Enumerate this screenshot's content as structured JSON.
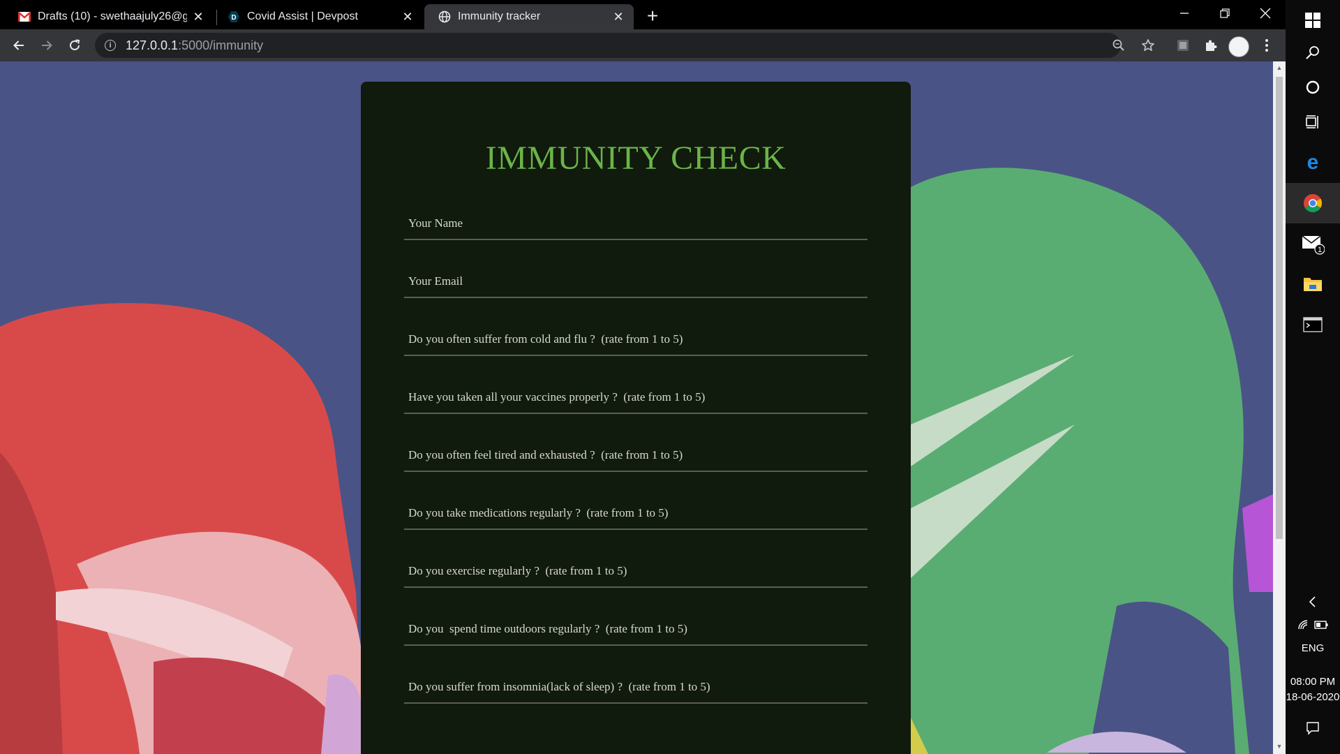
{
  "browser": {
    "tabs": [
      {
        "title": "Drafts (10) - swethaajuly26@gmail.com",
        "favicon": "gmail-icon",
        "active": false
      },
      {
        "title": "Covid Assist | Devpost",
        "favicon": "devpost-icon",
        "active": false
      },
      {
        "title": "Immunity tracker",
        "favicon": "globe-icon",
        "active": true
      }
    ],
    "url_host": "127.0.0.1",
    "url_path": ":5000/immunity",
    "devpost_letter": "D"
  },
  "form": {
    "title": "IMMUNITY CHECK",
    "fields": [
      {
        "placeholder": "Your Name"
      },
      {
        "placeholder": "Your Email"
      },
      {
        "placeholder": "Do you often suffer from cold and flu ?  (rate from 1 to 5)"
      },
      {
        "placeholder": "Have you taken all your vaccines properly ?  (rate from 1 to 5)"
      },
      {
        "placeholder": "Do you often feel tired and exhausted ?  (rate from 1 to 5)"
      },
      {
        "placeholder": "Do you take medications regularly ?  (rate from 1 to 5)"
      },
      {
        "placeholder": "Do you exercise regularly ?  (rate from 1 to 5)"
      },
      {
        "placeholder": "Do you  spend time outdoors regularly ?  (rate from 1 to 5)"
      },
      {
        "placeholder": "Do you suffer from insomnia(lack of sleep) ?  (rate from 1 to 5)"
      }
    ]
  },
  "taskbar": {
    "mail_badge": "1",
    "language": "ENG",
    "time": "08:00 PM",
    "date": "18-06-2020"
  },
  "colors": {
    "page_background": "#4a5386",
    "card_background": "#101a0d",
    "title_green": "#6bb448",
    "figure_red": "#d84a4a",
    "figure_green": "#5aad72"
  }
}
